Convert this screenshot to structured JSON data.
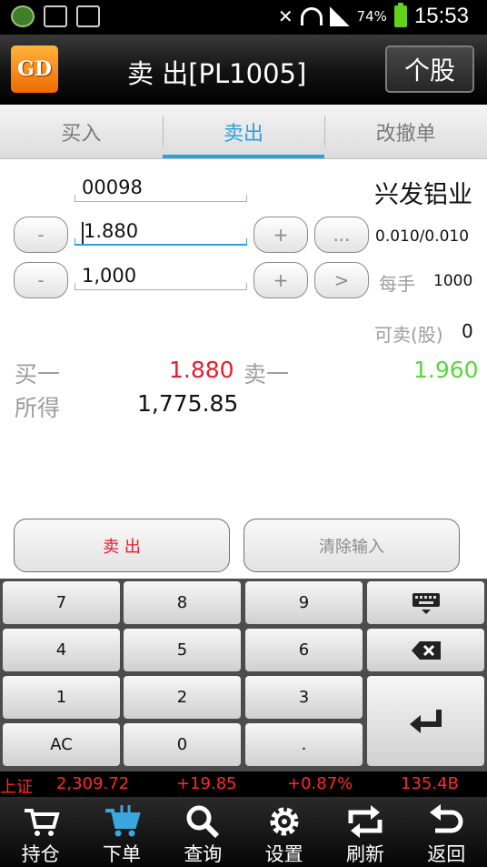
{
  "status_bar": {
    "battery": "74%",
    "time": "15:53"
  },
  "header": {
    "logo": "GD",
    "title": "卖 出[PL1005]",
    "stock_button": "个股"
  },
  "tabs": [
    {
      "label": "买入"
    },
    {
      "label": "卖出"
    },
    {
      "label": "改撤单"
    }
  ],
  "form": {
    "code": "00098",
    "stock_name": "兴发铝业",
    "price": "1.880",
    "price_step": "0.010/0.010",
    "quantity": "1,000",
    "lot_label": "每手",
    "lot_size": "1000",
    "sellable_label": "可卖(股)",
    "sellable": "0",
    "minus": "-",
    "plus": "+",
    "more": "...",
    "next": ">"
  },
  "quote": {
    "bid1_label": "买一",
    "bid1": "1.880",
    "ask1_label": "卖一",
    "ask1": "1.960",
    "proceeds_label": "所得",
    "proceeds": "1,775.85"
  },
  "actions": {
    "sell": "卖 出",
    "clear": "清除输入"
  },
  "keypad": {
    "keys": [
      "7",
      "8",
      "9",
      "4",
      "5",
      "6",
      "1",
      "2",
      "3",
      "AC",
      "0",
      "."
    ]
  },
  "ticker": {
    "index": "上证",
    "value": "2,309.72",
    "change": "+19.85",
    "pct": "+0.87%",
    "volume": "135.4B"
  },
  "colors": {
    "accent": "#2aa2dd",
    "up": "#e41d2b",
    "down": "#5bd43e"
  },
  "nav": [
    {
      "label": "持仓",
      "icon": "cart-icon"
    },
    {
      "label": "下单",
      "icon": "order-cart-icon"
    },
    {
      "label": "查询",
      "icon": "search-icon"
    },
    {
      "label": "设置",
      "icon": "gear-icon"
    },
    {
      "label": "刷新",
      "icon": "refresh-icon"
    },
    {
      "label": "返回",
      "icon": "back-icon"
    }
  ]
}
